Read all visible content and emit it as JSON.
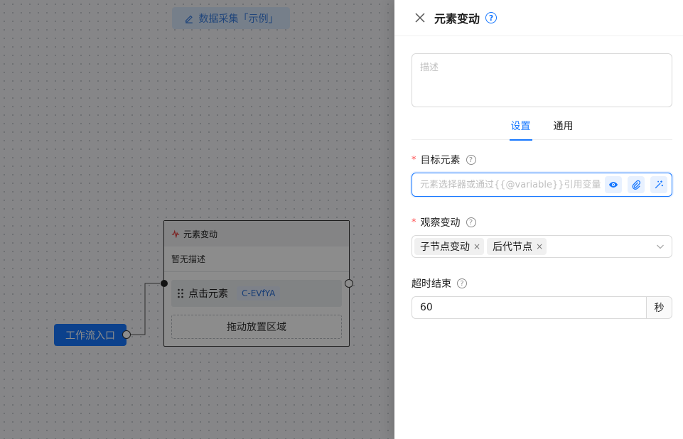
{
  "canvas": {
    "flow_title": "数据采集「示例」",
    "entry_node_label": "工作流入口",
    "node": {
      "title": "元素变动",
      "description": "暂无描述",
      "step_label": "点击元素",
      "step_tag": "C-EVfYA",
      "dropzone_label": "拖动放置区域"
    }
  },
  "drawer": {
    "title": "元素变动",
    "help_glyph": "?",
    "description_placeholder": "描述",
    "tabs": [
      {
        "label": "设置",
        "active": true
      },
      {
        "label": "通用",
        "active": false
      }
    ],
    "target": {
      "required_mark": "*",
      "label": "目标元素",
      "placeholder": "元素选择器或通过{{@variable}}引用变量"
    },
    "observe": {
      "required_mark": "*",
      "label": "观察变动",
      "selected": [
        "子节点变动",
        "后代节点"
      ],
      "remove_glyph": "×"
    },
    "timeout": {
      "label": "超时结束",
      "value": "60",
      "unit": "秒"
    },
    "question_glyph": "?"
  },
  "colors": {
    "accent": "#1677ff",
    "required": "#ff4d4f",
    "overlay": "rgba(0,0,0,0.45)"
  },
  "icons": {
    "close": "close-icon",
    "help": "help-icon",
    "edit": "pencil-icon",
    "pulse": "pulse-icon",
    "drag": "drag-handle-icon",
    "eye": "eye-icon",
    "attach": "paperclip-icon",
    "magic": "magic-wand-icon",
    "chevron": "chevron-down-icon"
  }
}
